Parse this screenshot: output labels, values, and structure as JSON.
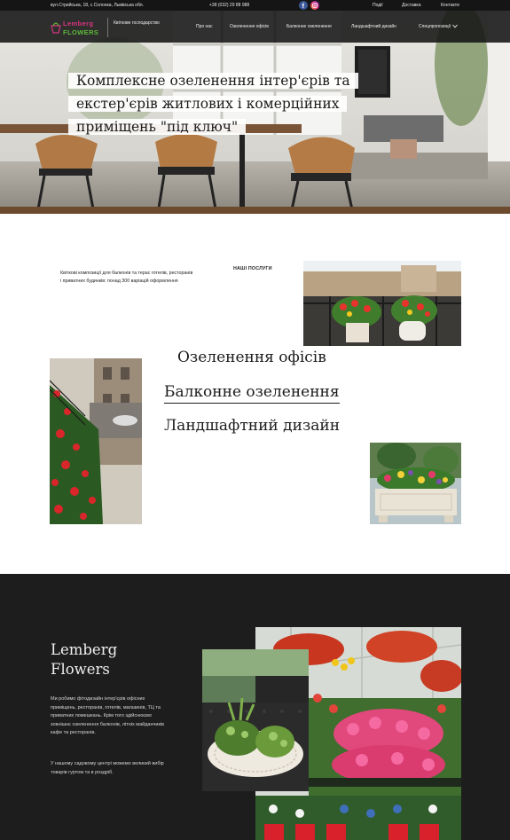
{
  "topbar": {
    "address": "вул.Стрийська, 18, с.Солонка, Львівська обл.",
    "phone": "+38 (032) 29 88 988",
    "links": [
      "Події",
      "Доставка",
      "Контакти"
    ]
  },
  "brand": {
    "logo_top": "Lemberg",
    "logo_bottom": "FLOWERS",
    "tagline": "Квіткове господарство",
    "pink": "#d8367f",
    "green": "#5fba3a"
  },
  "nav": {
    "items": [
      "Про нас",
      "Озеленення офісів",
      "Балконне озеленення",
      "Ландшафтний дизайн",
      "Спецпропозиції"
    ]
  },
  "hero": {
    "title_lines": [
      "Комплексне озеленення інтер'єрів та",
      "екстер'єрів житлових і комерційних",
      "приміщень \"під ключ\""
    ]
  },
  "services": {
    "intro": "Квіткові композиції для балконів та терас готелів, ресторанів і приватних будинків: понад 300 варіацій оформлення",
    "label": "НАШІ ПОСЛУГИ",
    "links": [
      "Озеленення офісів",
      "Балконне озеленення",
      "Ландшафтний дизайн"
    ]
  },
  "about": {
    "title_line1": "Lemberg",
    "title_line2": "Flowers",
    "p1": "Ми робимо фітодизайн інтер'єрів офісних приміщень, ресторанів, готелів, магазинів, ТЦ та приватних помешкань. Крім того здійснюємо зовнішнє озеленення балконів, літніх майданчиків кафе та ресторанів.",
    "p2": "У нашому садовому центрі можемо великий вибір товарів гуртом та в роздріб."
  }
}
